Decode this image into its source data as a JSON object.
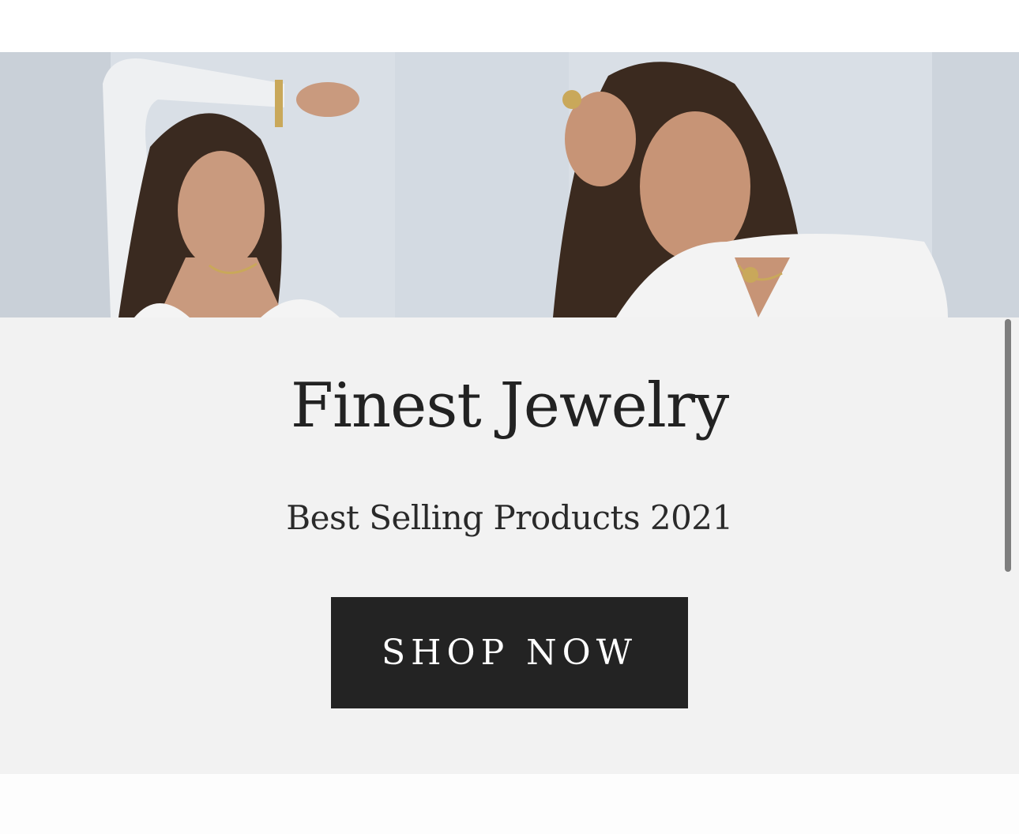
{
  "hero": {
    "title": "Finest Jewelry",
    "subtitle": "Best Selling Products 2021",
    "cta_label": "SHOP NOW",
    "colors": {
      "panel_background": "#f2f2f2",
      "button_background": "#232323",
      "button_text": "#ffffff",
      "text": "#222222"
    }
  }
}
